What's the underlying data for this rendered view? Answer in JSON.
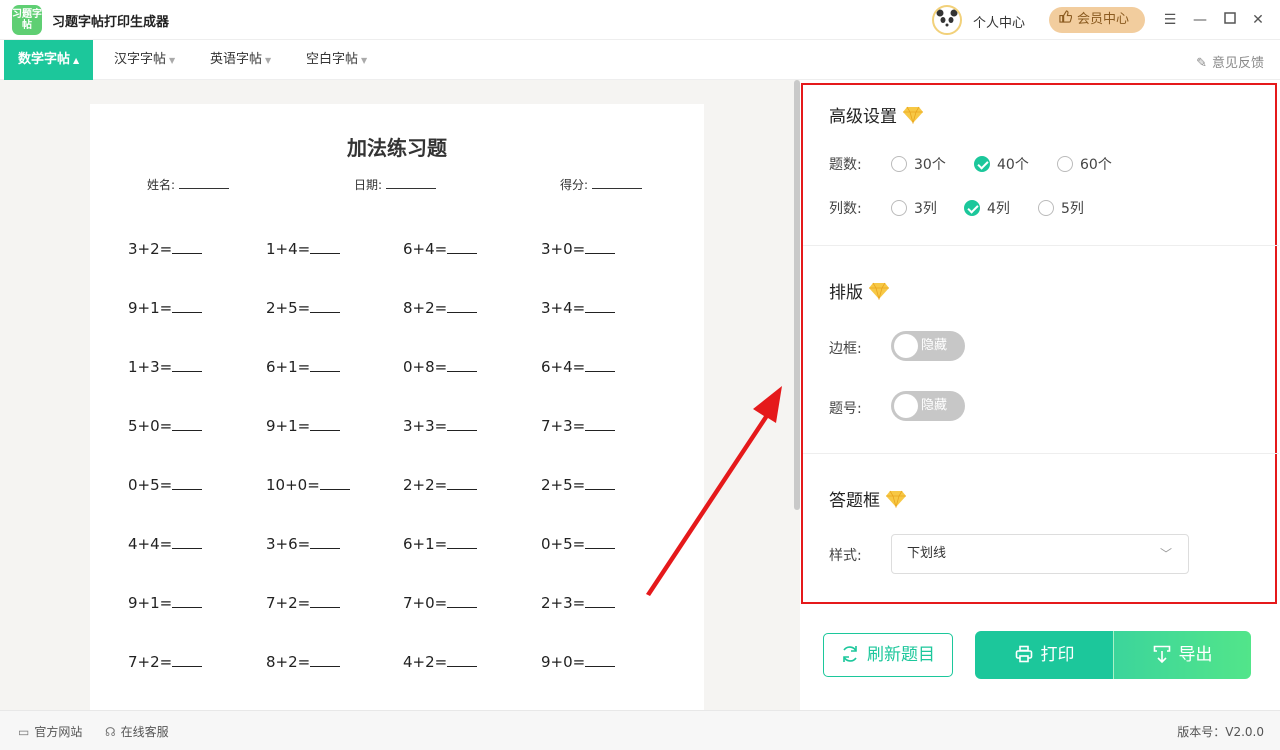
{
  "app": {
    "logo_text": "习题字帖",
    "title": "习题字帖打印生成器"
  },
  "header": {
    "personal_center": "个人中心",
    "member_center": "会员中心",
    "menu_icon": "menu-icon",
    "minimize_icon": "minimize-icon",
    "maximize_icon": "maximize-icon",
    "close_icon": "close-icon"
  },
  "tabs": [
    {
      "label": "数学字帖",
      "active": true
    },
    {
      "label": "汉字字帖",
      "active": false
    },
    {
      "label": "英语字帖",
      "active": false
    },
    {
      "label": "空白字帖",
      "active": false
    }
  ],
  "feedback": "意见反馈",
  "worksheet": {
    "title": "加法练习题",
    "name_label": "姓名:",
    "date_label": "日期:",
    "score_label": "得分:",
    "problems": [
      [
        "3+2=",
        "1+4=",
        "6+4=",
        "3+0="
      ],
      [
        "9+1=",
        "2+5=",
        "8+2=",
        "3+4="
      ],
      [
        "1+3=",
        "6+1=",
        "0+8=",
        "6+4="
      ],
      [
        "5+0=",
        "9+1=",
        "3+3=",
        "7+3="
      ],
      [
        "0+5=",
        "10+0=",
        "2+2=",
        "2+5="
      ],
      [
        "4+4=",
        "3+6=",
        "6+1=",
        "0+5="
      ],
      [
        "9+1=",
        "7+2=",
        "7+0=",
        "2+3="
      ],
      [
        "7+2=",
        "8+2=",
        "4+2=",
        "9+0="
      ]
    ]
  },
  "settings": {
    "advanced": {
      "title": "高级设置",
      "count_label": "题数:",
      "count_options": [
        "30个",
        "40个",
        "60个"
      ],
      "count_selected": "40个",
      "columns_label": "列数:",
      "column_options": [
        "3列",
        "4列",
        "5列"
      ],
      "columns_selected": "4列"
    },
    "layout": {
      "title": "排版",
      "border_label": "边框:",
      "border_toggle": "隐藏",
      "number_label": "题号:",
      "number_toggle": "隐藏"
    },
    "answer_box": {
      "title": "答题框",
      "style_label": "样式:",
      "style_value": "下划线"
    }
  },
  "actions": {
    "refresh": "刷新题目",
    "print": "打印",
    "export": "导出"
  },
  "status": {
    "website": "官方网站",
    "support": "在线客服",
    "version": "版本号：V2.0.0"
  },
  "colors": {
    "accent": "#1cc79b",
    "highlight_border": "#e5191b",
    "arrow": "#e5191b",
    "member": "#f2cd9e"
  }
}
